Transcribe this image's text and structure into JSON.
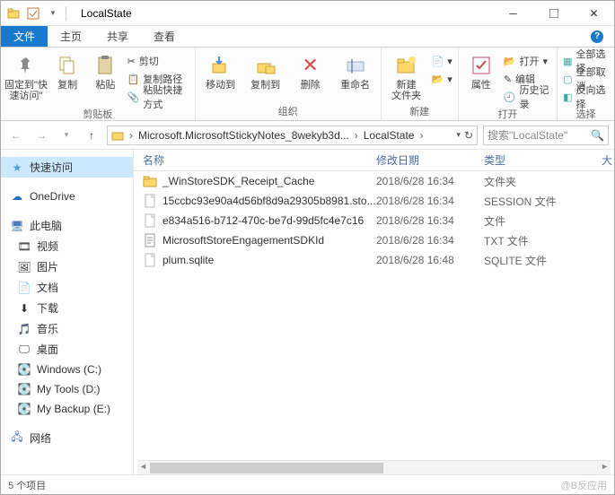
{
  "title": "LocalState",
  "tabs": {
    "file": "文件",
    "home": "主页",
    "share": "共享",
    "view": "查看"
  },
  "ribbon": {
    "pin": "固定到\"快\n速访问\"",
    "copy": "复制",
    "paste": "粘贴",
    "cut": "剪切",
    "copypath": "复制路径",
    "pasteshortcut": "粘贴快捷方式",
    "group_clipboard": "剪贴板",
    "moveto": "移动到",
    "copyto": "复制到",
    "delete": "删除",
    "rename": "重命名",
    "group_organize": "组织",
    "newfolder": "新建\n文件夹",
    "group_new": "新建",
    "properties": "属性",
    "open": "打开",
    "edit": "编辑",
    "history": "历史记录",
    "group_open": "打开",
    "selectall": "全部选择",
    "selectnone": "全部取消",
    "selectinvert": "反向选择",
    "group_select": "选择"
  },
  "path": {
    "seg1": "Microsoft.MicrosoftStickyNotes_8wekyb3d...",
    "seg2": "LocalState"
  },
  "search_placeholder": "搜索\"LocalState\"",
  "sidebar": {
    "quick": "快速访问",
    "onedrive": "OneDrive",
    "thispc": "此电脑",
    "videos": "视频",
    "pictures": "图片",
    "documents": "文档",
    "downloads": "下载",
    "music": "音乐",
    "desktop": "桌面",
    "c": "Windows (C:)",
    "d": "My Tools (D:)",
    "e": "My Backup (E:)",
    "network": "网络"
  },
  "columns": {
    "name": "名称",
    "date": "修改日期",
    "type": "类型",
    "size": "大"
  },
  "files": [
    {
      "name": "_WinStoreSDK_Receipt_Cache",
      "date": "2018/6/28 16:34",
      "type": "文件夹",
      "icon": "folder"
    },
    {
      "name": "15ccbc93e90a4d56bf8d9a29305b8981.sto...",
      "date": "2018/6/28 16:34",
      "type": "SESSION 文件",
      "icon": "file"
    },
    {
      "name": "e834a516-b712-470c-be7d-99d5fc4e7c16",
      "date": "2018/6/28 16:34",
      "type": "文件",
      "icon": "file"
    },
    {
      "name": "MicrosoftStoreEngagementSDKId",
      "date": "2018/6/28 16:34",
      "type": "TXT 文件",
      "icon": "txt"
    },
    {
      "name": "plum.sqlite",
      "date": "2018/6/28 16:48",
      "type": "SQLITE 文件",
      "icon": "file"
    }
  ],
  "status": "5 个项目",
  "watermark": "@B反应用"
}
